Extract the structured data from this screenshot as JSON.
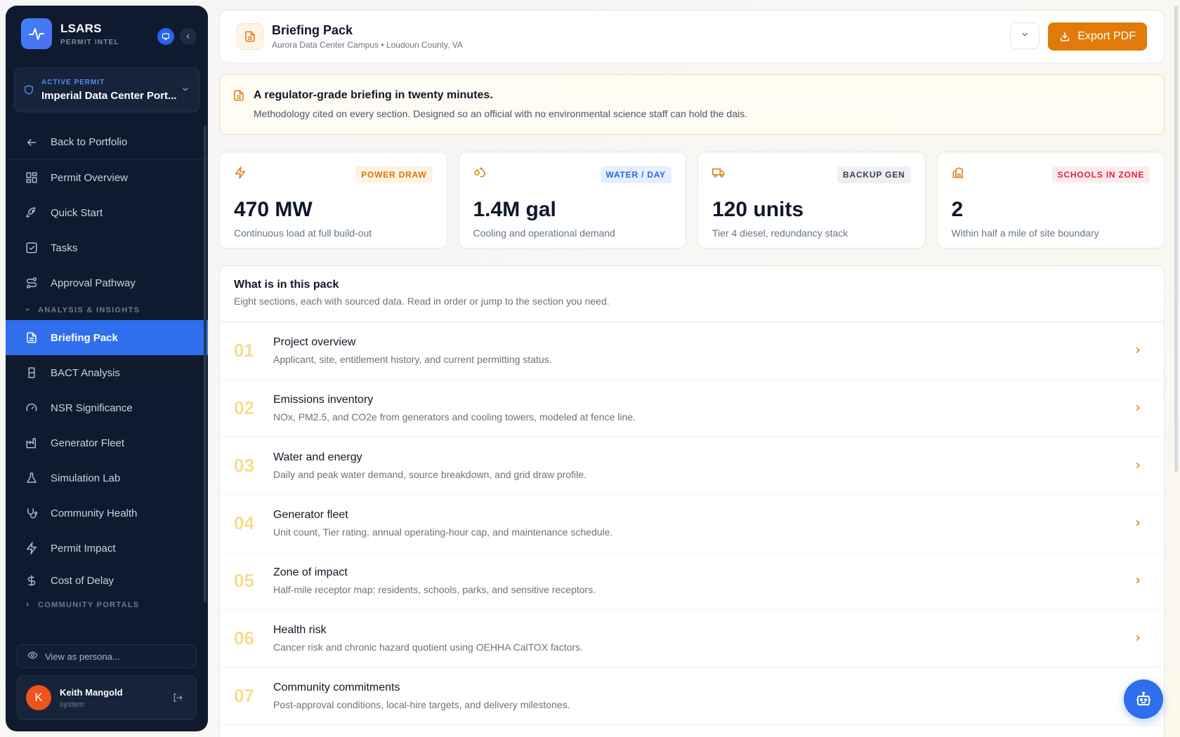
{
  "sidebar": {
    "brand": {
      "name": "LSARS",
      "subtitle": "PERMIT INTEL"
    },
    "permit": {
      "label": "ACTIVE PERMIT",
      "name": "Imperial Data Center Port..."
    },
    "items_top": [
      {
        "label": "Back to Portfolio",
        "icon": "arrow-left-icon"
      },
      {
        "label": "Permit Overview",
        "icon": "grid-icon"
      },
      {
        "label": "Quick Start",
        "icon": "rocket-icon"
      },
      {
        "label": "Tasks",
        "icon": "checkbox-icon"
      },
      {
        "label": "Approval Pathway",
        "icon": "route-icon"
      }
    ],
    "group_analysis": "ANALYSIS & INSIGHTS",
    "items_analysis": [
      {
        "label": "Briefing Pack",
        "icon": "document-icon"
      },
      {
        "label": "BACT Analysis",
        "icon": "filter-icon"
      },
      {
        "label": "NSR Significance",
        "icon": "gauge-icon"
      },
      {
        "label": "Generator Fleet",
        "icon": "factory-icon"
      },
      {
        "label": "Simulation Lab",
        "icon": "flask-icon"
      },
      {
        "label": "Community Health",
        "icon": "stethoscope-icon"
      },
      {
        "label": "Permit Impact",
        "icon": "lightning-icon"
      },
      {
        "label": "Cost of Delay",
        "icon": "dollar-icon"
      }
    ],
    "group_portals": "COMMUNITY PORTALS",
    "persona": "View as persona...",
    "user": {
      "initial": "K",
      "name": "Keith Mangold",
      "role": "system"
    }
  },
  "header": {
    "title": "Briefing Pack",
    "subtitle": "Aurora Data Center Campus • Loudoun County, VA",
    "export_label": "Export PDF"
  },
  "callout": {
    "title": "A regulator-grade briefing in twenty minutes.",
    "text": "Methodology cited on every section. Designed so an official with no environmental science staff can hold the dais."
  },
  "kpis": [
    {
      "tag": "POWER DRAW",
      "value": "470 MW",
      "desc": "Continuous load at full build-out",
      "icon": "lightning-icon"
    },
    {
      "tag": "WATER / DAY",
      "value": "1.4M gal",
      "desc": "Cooling and operational demand",
      "icon": "droplets-icon"
    },
    {
      "tag": "BACKUP GEN",
      "value": "120 units",
      "desc": "Tier 4 diesel, redundancy stack",
      "icon": "truck-icon"
    },
    {
      "tag": "SCHOOLS IN ZONE",
      "value": "2",
      "desc": "Within half a mile of site boundary",
      "icon": "school-icon"
    }
  ],
  "pack": {
    "title": "What is in this pack",
    "subtitle": "Eight sections, each with sourced data. Read in order or jump to the section you need.",
    "sections": [
      {
        "num": "01",
        "title": "Project overview",
        "desc": "Applicant, site, entitlement history, and current permitting status."
      },
      {
        "num": "02",
        "title": "Emissions inventory",
        "desc": "NOx, PM2.5, and CO2e from generators and cooling towers, modeled at fence line."
      },
      {
        "num": "03",
        "title": "Water and energy",
        "desc": "Daily and peak water demand, source breakdown, and grid draw profile."
      },
      {
        "num": "04",
        "title": "Generator fleet",
        "desc": "Unit count, Tier rating, annual operating-hour cap, and maintenance schedule."
      },
      {
        "num": "05",
        "title": "Zone of impact",
        "desc": "Half-mile receptor map: residents, schools, parks, and sensitive receptors."
      },
      {
        "num": "06",
        "title": "Health risk",
        "desc": "Cancer risk and chronic hazard quotient using OEHHA CalTOX factors."
      },
      {
        "num": "07",
        "title": "Community commitments",
        "desc": "Post-approval conditions, local-hire targets, and delivery milestones."
      }
    ]
  },
  "colors": {
    "accent": "#2f6fed",
    "orange": "#e07b0a",
    "sidebar": "#0f1a2e"
  }
}
